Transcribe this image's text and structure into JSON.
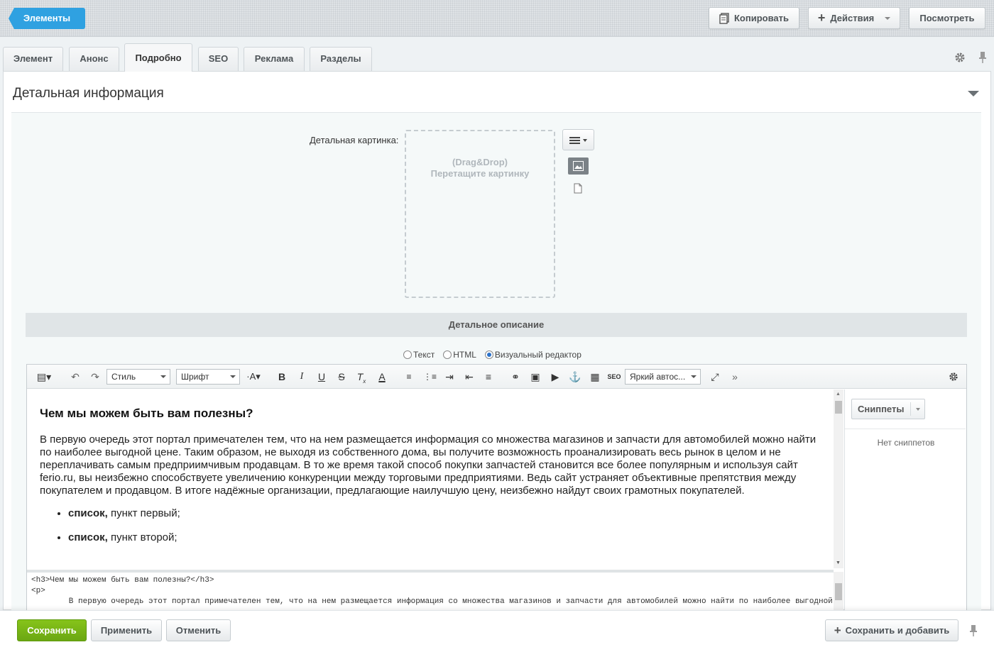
{
  "topbar": {
    "back_label": "Элементы",
    "copy_label": "Копировать",
    "actions_label": "Действия",
    "view_label": "Посмотреть"
  },
  "tabs": [
    {
      "label": "Элемент"
    },
    {
      "label": "Анонс"
    },
    {
      "label": "Подробно",
      "active": true
    },
    {
      "label": "SEO"
    },
    {
      "label": "Реклама"
    },
    {
      "label": "Разделы"
    }
  ],
  "section": {
    "title": "Детальная информация",
    "picture_label": "Детальная картинка:",
    "dropzone_line1": "(Drag&Drop)",
    "dropzone_line2": "Перетащите картинку",
    "description_header": "Детальное описание"
  },
  "mode": {
    "options": [
      "Текст",
      "HTML",
      "Визуальный редактор"
    ],
    "selected": "Визуальный редактор"
  },
  "toolbar": {
    "style_select": "Стиль",
    "font_select": "Шрифт",
    "snippet_select": "Яркий автос..."
  },
  "content": {
    "heading": "Чем мы можем быть вам полезны?",
    "paragraph": "В первую очередь этот портал примечателен тем, что на нем размещается информация со множества магазинов и запчасти для автомобилей можно найти по наиболее выгодной цене. Таким образом, не выходя из собственного дома, вы получите возможность проанализировать весь рынок в целом и не переплачивать самым предприимчивым продавцам. В то же время такой способ покупки запчастей становится все более популярным и используя сайт ferio.ru, вы неизбежно способствуете увеличению конкуренции между торговыми предприятиями. Ведь сайт устраняет объективные препятствия между покупателем и продавцом. В итоге надёжные организации, предлагающие наилучшую цену, неизбежно найдут своих грамотных покупателей.",
    "list": [
      {
        "bold": "список,",
        "rest": " пункт первый;"
      },
      {
        "bold": "список,",
        "rest": " пункт второй;"
      }
    ]
  },
  "code": {
    "line1": "<h3>Чем мы можем быть вам полезны?</h3>",
    "line2": "<p>",
    "line3": "        В первую очередь этот портал примечателен тем, что на нем размещается информация со множества магазинов и запчасти для автомобилей можно найти по наиболее выгодной цене."
  },
  "snippets": {
    "button_label": "Сниппеты",
    "empty_text": "Нет сниппетов"
  },
  "footer": {
    "save": "Сохранить",
    "apply": "Применить",
    "cancel": "Отменить",
    "save_add": "Сохранить и добавить"
  },
  "colors": {
    "back_button": "#2fa1e1",
    "save_button": "#7ab515"
  }
}
